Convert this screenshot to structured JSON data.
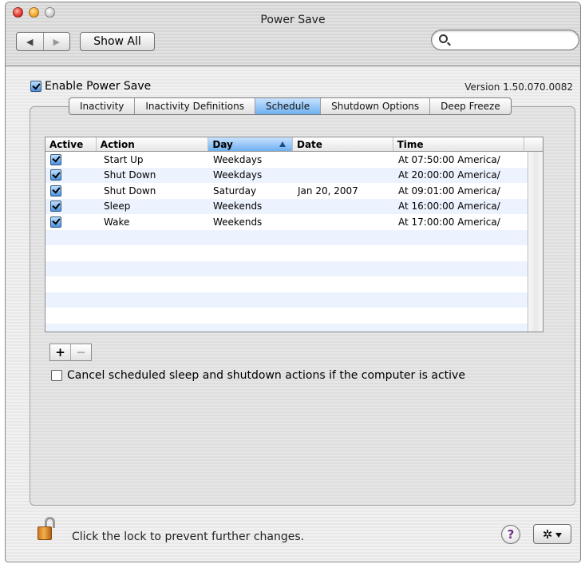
{
  "window": {
    "title": "Power Save"
  },
  "toolbar": {
    "back_icon": "◀",
    "forward_icon": "▶",
    "show_all_label": "Show All",
    "search": {
      "value": "",
      "placeholder": ""
    }
  },
  "header": {
    "enable_label": "Enable Power Save",
    "enable_checked": true,
    "version": "Version 1.50.070.0082"
  },
  "tabs": [
    {
      "label": "Inactivity",
      "selected": false
    },
    {
      "label": "Inactivity Definitions",
      "selected": false
    },
    {
      "label": "Schedule",
      "selected": true
    },
    {
      "label": "Shutdown Options",
      "selected": false
    },
    {
      "label": "Deep Freeze",
      "selected": false
    }
  ],
  "schedule_table": {
    "columns": {
      "active": "Active",
      "action": "Action",
      "day": "Day",
      "date": "Date",
      "time": "Time"
    },
    "sorted_column": "day",
    "rows": [
      {
        "active": true,
        "action": "Start Up",
        "day": "Weekdays",
        "date": "",
        "time": "At 07:50:00 America/"
      },
      {
        "active": true,
        "action": "Shut Down",
        "day": "Weekdays",
        "date": "",
        "time": "At 20:00:00 America/"
      },
      {
        "active": true,
        "action": "Shut Down",
        "day": "Saturday",
        "date": "Jan 20, 2007",
        "time": "At 09:01:00 America/"
      },
      {
        "active": true,
        "action": "Sleep",
        "day": "Weekends",
        "date": "",
        "time": "At 16:00:00 America/"
      },
      {
        "active": true,
        "action": "Wake",
        "day": "Weekends",
        "date": "",
        "time": "At 17:00:00 America/"
      },
      {
        "active": null,
        "action": "",
        "day": "",
        "date": "",
        "time": ""
      },
      {
        "active": null,
        "action": "",
        "day": "",
        "date": "",
        "time": ""
      },
      {
        "active": null,
        "action": "",
        "day": "",
        "date": "",
        "time": ""
      },
      {
        "active": null,
        "action": "",
        "day": "",
        "date": "",
        "time": ""
      },
      {
        "active": null,
        "action": "",
        "day": "",
        "date": "",
        "time": ""
      },
      {
        "active": null,
        "action": "",
        "day": "",
        "date": "",
        "time": ""
      },
      {
        "active": null,
        "action": "",
        "day": "",
        "date": "",
        "time": ""
      }
    ]
  },
  "row_buttons": {
    "add": "+",
    "remove": "−"
  },
  "cancel_option": {
    "label": "Cancel scheduled sleep and shutdown actions if the computer is active",
    "checked": false
  },
  "footer": {
    "lock_text": "Click the lock to prevent further changes.",
    "help_label": "?",
    "action_icon": "✲"
  }
}
